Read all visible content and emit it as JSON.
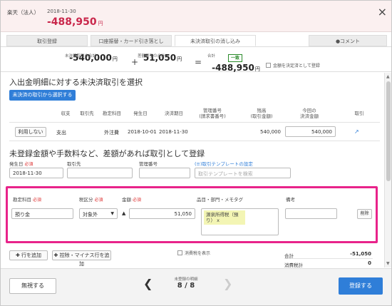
{
  "header": {
    "bank_name": "楽天（法人）",
    "date": "2018-11-30",
    "amount": "-488,950",
    "amount_unit": "円",
    "close_label": "×"
  },
  "tabs": [
    {
      "label": "取引登録"
    },
    {
      "label": "口座振替・カード引き落とし"
    },
    {
      "label": "未決済取引の消し込み"
    },
    {
      "label": "●コメント"
    }
  ],
  "summary": {
    "unsettled_label": "未決済取引の合計",
    "unsettled_value": "-540,000",
    "diff_label": "差額取引の合計",
    "diff_value": "51,050",
    "total_label": "合計",
    "total_badge": "一致",
    "total_value": "-488,950",
    "unit": "円",
    "plus": "+",
    "equals": "=",
    "checkbox_label": "金額を決定済として登録"
  },
  "section1": {
    "title": "入出金明細に対する未決済取引を選択",
    "select_button": "未決済の取引から選択する",
    "columns": [
      "収支",
      "取引先",
      "勘定科目",
      "発生日",
      "決済期日",
      "管理番号\n(請求書番号)",
      "残高\n(取引金額)",
      "今回の\n決済金額",
      "取引"
    ],
    "row": {
      "unuse_button": "利用しない",
      "type": "支出",
      "partner": "",
      "account": "外注費",
      "issue_date": "2018-10-01",
      "due_date": "2018-11-30",
      "control_no": "",
      "balance": "540,000",
      "payment": "540,000"
    }
  },
  "section2": {
    "title": "未登録金額や手数料など、差額があれば取引として登録",
    "issue_date_label": "発生日",
    "required": "必須",
    "issue_date_value": "2018-11-30",
    "partner_label": "取引先",
    "control_label": "管理番号",
    "template_link": "(≡)取引テンプレートの設定",
    "template_placeholder": "取引テンプレートを検索"
  },
  "detail": {
    "account_label": "勘定科目",
    "tax_label": "税区分",
    "amount_label": "金額",
    "item_label": "品目・部門・メモタグ",
    "note_label": "備考",
    "account_value": "預り金",
    "tax_value": "対象外",
    "sign": "▲",
    "amount_value": "51,050",
    "tag_line1": "源泉所得税（預",
    "tag_line2": "り）",
    "tag_remove": "x",
    "delete_button": "削除"
  },
  "actions": {
    "add_row": "行を追加",
    "add_minus_row": "控除・マイナス行を追加",
    "show_tax_label": "消費税を表示",
    "total_label": "合計",
    "total_value": "-51,050",
    "tax_total_label": "消費税計",
    "tax_total_value": "0"
  },
  "footer": {
    "ignore_button": "無視する",
    "nav_label": "未登録の明細",
    "nav_value": "8 / 8",
    "register_button": "登録する"
  }
}
